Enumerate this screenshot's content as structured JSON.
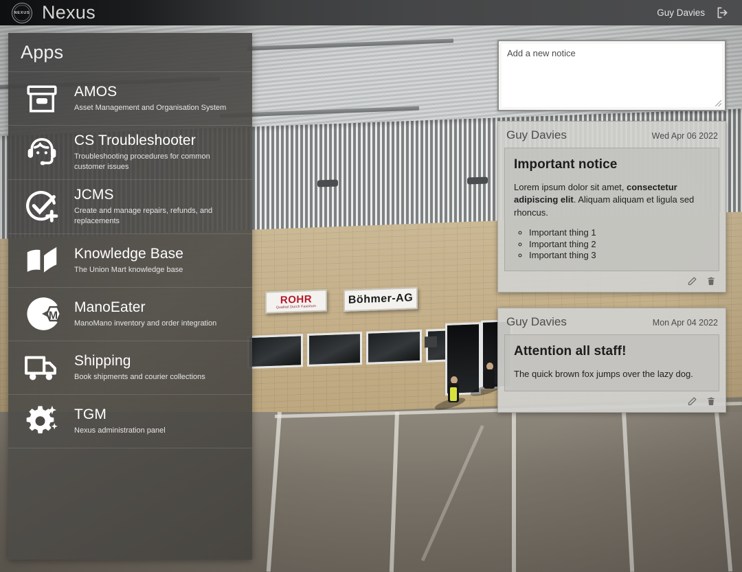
{
  "topbar": {
    "emblem_text": "Nexus",
    "brand_title": "Nexus",
    "user_name": "Guy Davies",
    "logout_icon": "logout-icon"
  },
  "apps_panel": {
    "title": "Apps",
    "items": [
      {
        "icon": "archive-box-icon",
        "name": "AMOS",
        "desc": "Asset Management and Organisation System"
      },
      {
        "icon": "headset-support-icon",
        "name": "CS Troubleshooter",
        "desc": "Troubleshooting procedures for common customer issues"
      },
      {
        "icon": "check-circle-plus-icon",
        "name": "JCMS",
        "desc": "Create and manage repairs, refunds, and replacements"
      },
      {
        "icon": "open-book-icon",
        "name": "Knowledge Base",
        "desc": "The Union Mart knowledge base"
      },
      {
        "icon": "manomano-pacman-icon",
        "name": "ManoEater",
        "desc": "ManoMano inventory and order integration"
      },
      {
        "icon": "delivery-truck-icon",
        "name": "Shipping",
        "desc": "Book shipments and courier collections"
      },
      {
        "icon": "gear-sparkle-icon",
        "name": "TGM",
        "desc": "Nexus administration panel"
      }
    ]
  },
  "notices": {
    "new_notice_placeholder": "Add a new notice",
    "new_notice_value": "",
    "cards": [
      {
        "author": "Guy Davies",
        "date": "Wed Apr 06 2022",
        "title": "Important notice",
        "paragraph_pre": "Lorem ipsum dolor sit amet, ",
        "paragraph_bold": "consectetur adipiscing elit",
        "paragraph_post": ". Aliquam aliquam et ligula sed rhoncus.",
        "list": [
          "Important thing 1",
          "Important thing 2",
          "Important thing 3"
        ],
        "edit_icon": "pencil-icon",
        "delete_icon": "trash-icon"
      },
      {
        "author": "Guy Davies",
        "date": "Mon Apr 04 2022",
        "title": "Attention all staff!",
        "paragraph_pre": "The quick brown fox jumps over the lazy dog.",
        "paragraph_bold": "",
        "paragraph_post": "",
        "list": [],
        "edit_icon": "pencil-icon",
        "delete_icon": "trash-icon"
      }
    ]
  },
  "background": {
    "sign_left_main": "ROHR",
    "sign_left_sub": "Qualitat Durch Fassitum",
    "sign_right_main": "Böhmer-AG"
  },
  "colors": {
    "topbar_dark": "#0e0f10",
    "topbar_light": "#4c4d4e",
    "panel_bg": "#4a4945",
    "notice_bg": "#d1d1cd",
    "notice_body_bg": "#c0c0bc",
    "sign_red": "#b5172a"
  }
}
